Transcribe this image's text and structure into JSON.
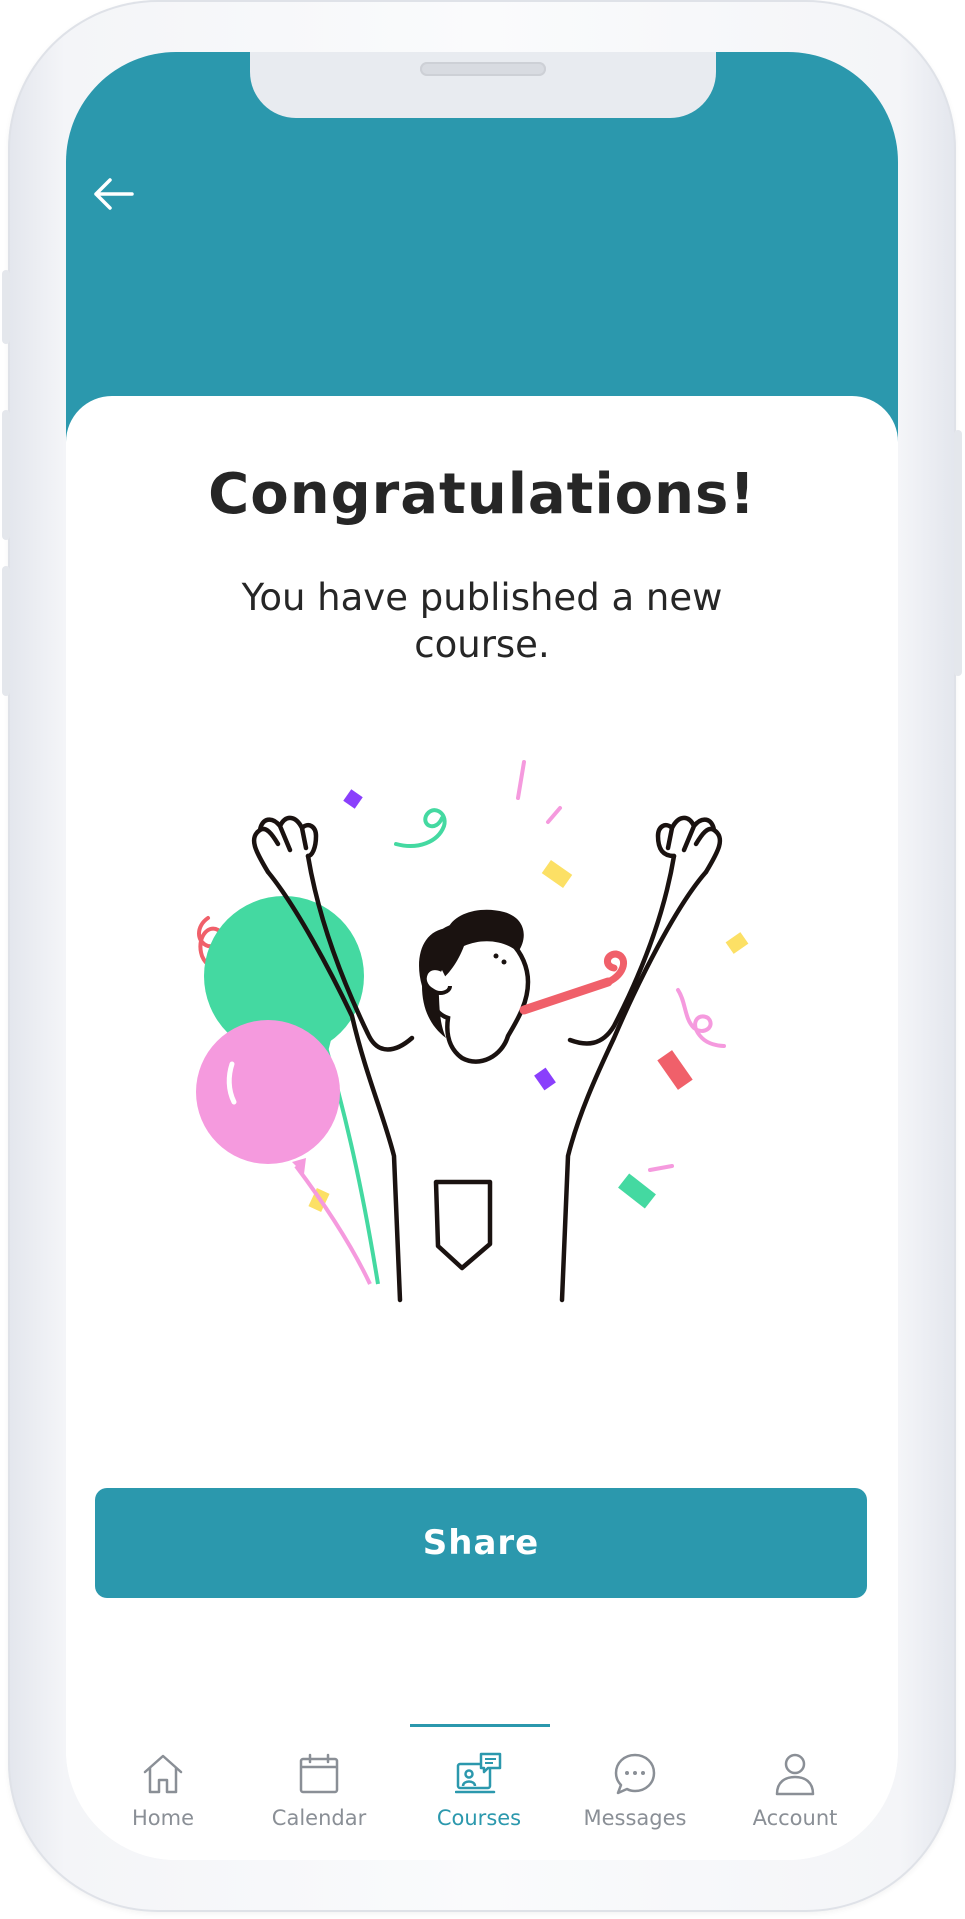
{
  "colors": {
    "accent": "#2b98ad",
    "text": "#262626",
    "nav_inactive": "#8a8f96",
    "balloon_green": "#44d9a1",
    "balloon_pink": "#f59ade"
  },
  "header": {
    "back_icon": "arrow-left-icon"
  },
  "content": {
    "title": "Congratulations!",
    "subtitle": "You have published a new course.",
    "illustration": "celebrating-person-with-balloons"
  },
  "actions": {
    "share_label": "Share"
  },
  "bottom_nav": {
    "active_index": 2,
    "items": [
      {
        "label": "Home",
        "icon": "home-icon"
      },
      {
        "label": "Calendar",
        "icon": "calendar-icon"
      },
      {
        "label": "Courses",
        "icon": "courses-icon"
      },
      {
        "label": "Messages",
        "icon": "chat-bubble-icon"
      },
      {
        "label": "Account",
        "icon": "user-icon"
      }
    ]
  }
}
